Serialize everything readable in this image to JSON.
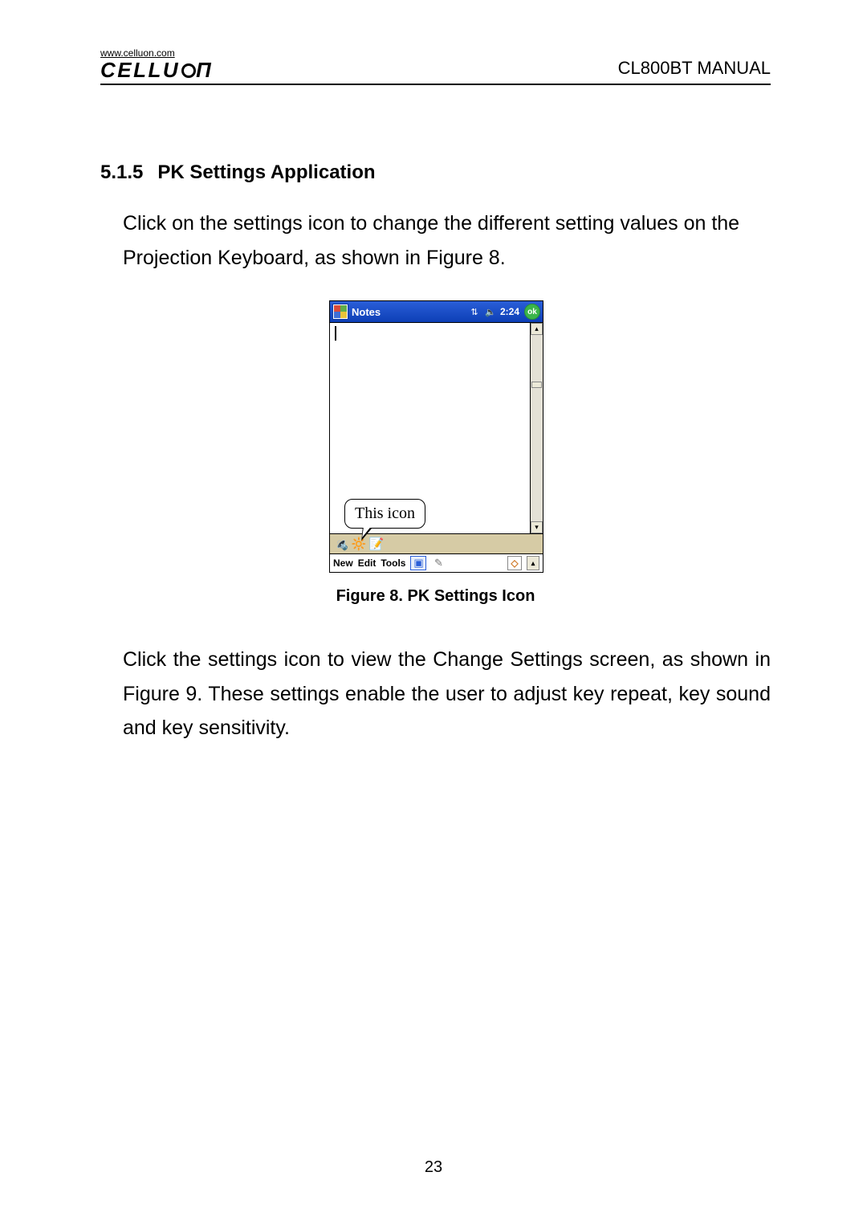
{
  "header": {
    "logo_url": "www.celluon.com",
    "brand_text": "CELLU",
    "manual_title": "CL800BT MANUAL"
  },
  "section": {
    "number": "5.1.5",
    "title": "PK Settings Application"
  },
  "paragraph1": "Click on the settings icon to change the different setting values on the Projection Keyboard, as shown in Figure 8.",
  "figure": {
    "caption": "Figure 8. PK Settings Icon",
    "pda": {
      "app_title": "Notes",
      "time": "2:24",
      "ok_label": "ok",
      "callout_text": "This icon",
      "menubar": {
        "new": "New",
        "edit": "Edit",
        "tools": "Tools"
      }
    }
  },
  "paragraph2": "Click the settings icon to view the Change Settings screen, as shown in Figure 9. These settings enable the user to adjust key repeat, key sound and key sensitivity.",
  "page_number": "23"
}
